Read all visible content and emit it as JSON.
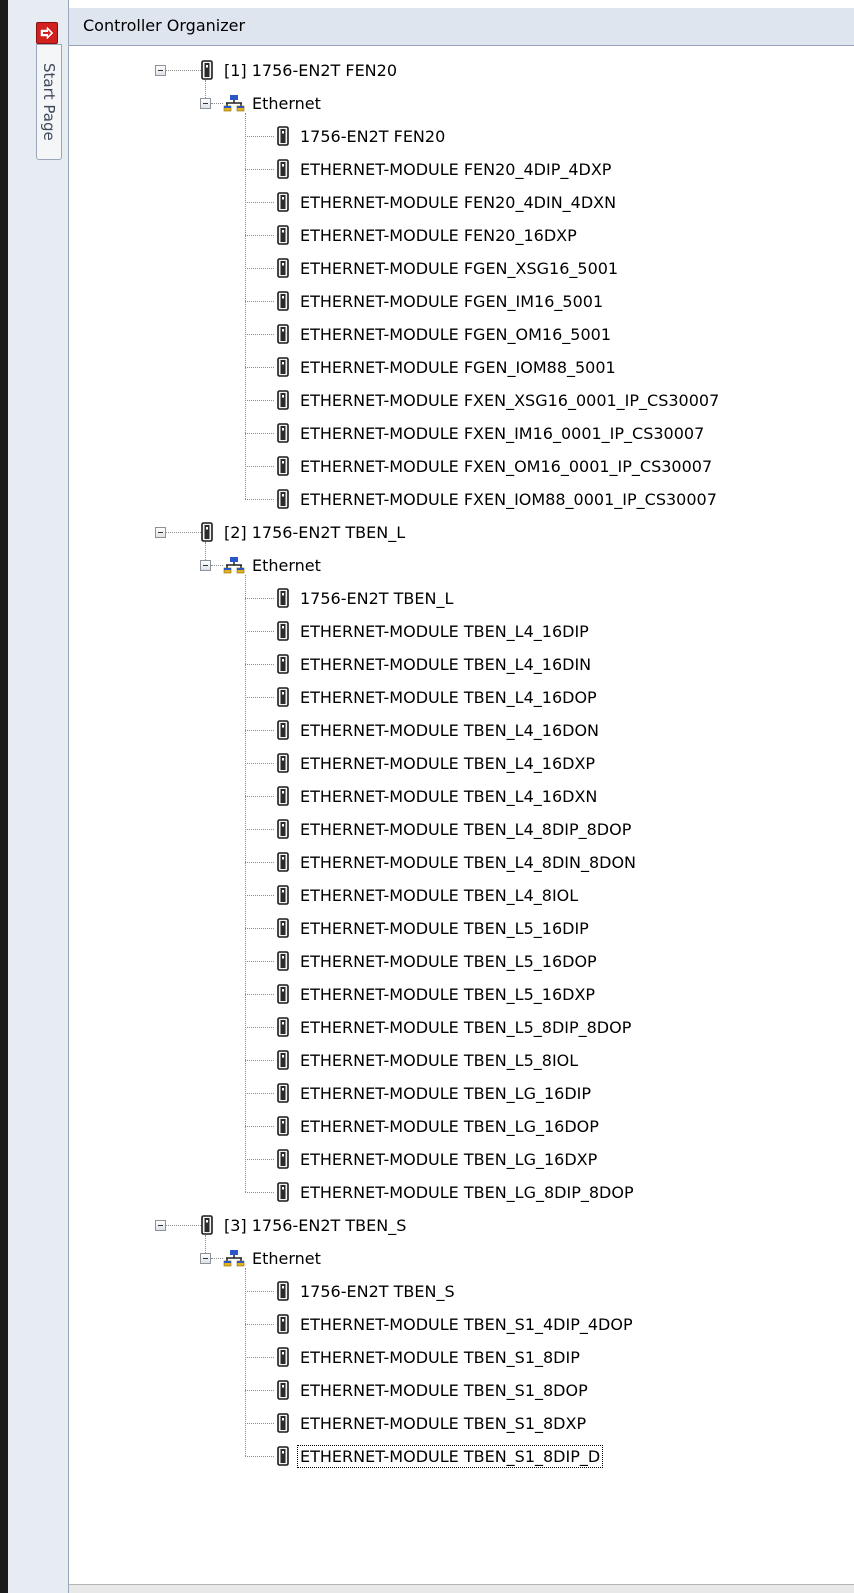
{
  "window": {
    "title": "Controller Organizer",
    "side_tab_label": "Start Page"
  },
  "tree": [
    {
      "label": "[1] 1756-EN2T FEN20",
      "network": "Ethernet",
      "children": [
        "1756-EN2T FEN20",
        "ETHERNET-MODULE FEN20_4DIP_4DXP",
        "ETHERNET-MODULE FEN20_4DIN_4DXN",
        "ETHERNET-MODULE FEN20_16DXP",
        "ETHERNET-MODULE FGEN_XSG16_5001",
        "ETHERNET-MODULE FGEN_IM16_5001",
        "ETHERNET-MODULE FGEN_OM16_5001",
        "ETHERNET-MODULE FGEN_IOM88_5001",
        "ETHERNET-MODULE FXEN_XSG16_0001_IP_CS30007",
        "ETHERNET-MODULE FXEN_IM16_0001_IP_CS30007",
        "ETHERNET-MODULE FXEN_OM16_0001_IP_CS30007",
        "ETHERNET-MODULE FXEN_IOM88_0001_IP_CS30007"
      ]
    },
    {
      "label": "[2] 1756-EN2T TBEN_L",
      "network": "Ethernet",
      "children": [
        "1756-EN2T TBEN_L",
        "ETHERNET-MODULE TBEN_L4_16DIP",
        "ETHERNET-MODULE TBEN_L4_16DIN",
        "ETHERNET-MODULE TBEN_L4_16DOP",
        "ETHERNET-MODULE TBEN_L4_16DON",
        "ETHERNET-MODULE TBEN_L4_16DXP",
        "ETHERNET-MODULE TBEN_L4_16DXN",
        "ETHERNET-MODULE TBEN_L4_8DIP_8DOP",
        "ETHERNET-MODULE TBEN_L4_8DIN_8DON",
        "ETHERNET-MODULE TBEN_L4_8IOL",
        "ETHERNET-MODULE TBEN_L5_16DIP",
        "ETHERNET-MODULE TBEN_L5_16DOP",
        "ETHERNET-MODULE TBEN_L5_16DXP",
        "ETHERNET-MODULE TBEN_L5_8DIP_8DOP",
        "ETHERNET-MODULE TBEN_L5_8IOL",
        "ETHERNET-MODULE TBEN_LG_16DIP",
        "ETHERNET-MODULE TBEN_LG_16DOP",
        "ETHERNET-MODULE TBEN_LG_16DXP",
        "ETHERNET-MODULE TBEN_LG_8DIP_8DOP"
      ]
    },
    {
      "label": "[3] 1756-EN2T TBEN_S",
      "network": "Ethernet",
      "children": [
        "1756-EN2T TBEN_S",
        "ETHERNET-MODULE TBEN_S1_4DIP_4DOP",
        "ETHERNET-MODULE TBEN_S1_8DIP",
        "ETHERNET-MODULE TBEN_S1_8DOP",
        "ETHERNET-MODULE TBEN_S1_8DXP",
        "ETHERNET-MODULE TBEN_S1_8DIP_D"
      ]
    }
  ],
  "selected_item": "ETHERNET-MODULE TBEN_S1_8DIP_D",
  "colors": {
    "title_bar": "#dfe5ee",
    "side_strip": "#e7ebf2",
    "start_page_icon": "#d0211f",
    "network_icon_top": "#2a56c6",
    "network_icon_bottom": "#e2b21c"
  },
  "icons": {
    "node": "module-icon",
    "network": "ethernet-network-icon",
    "expander": "collapse-icon",
    "side_tab": "start-page-arrow-icon"
  }
}
